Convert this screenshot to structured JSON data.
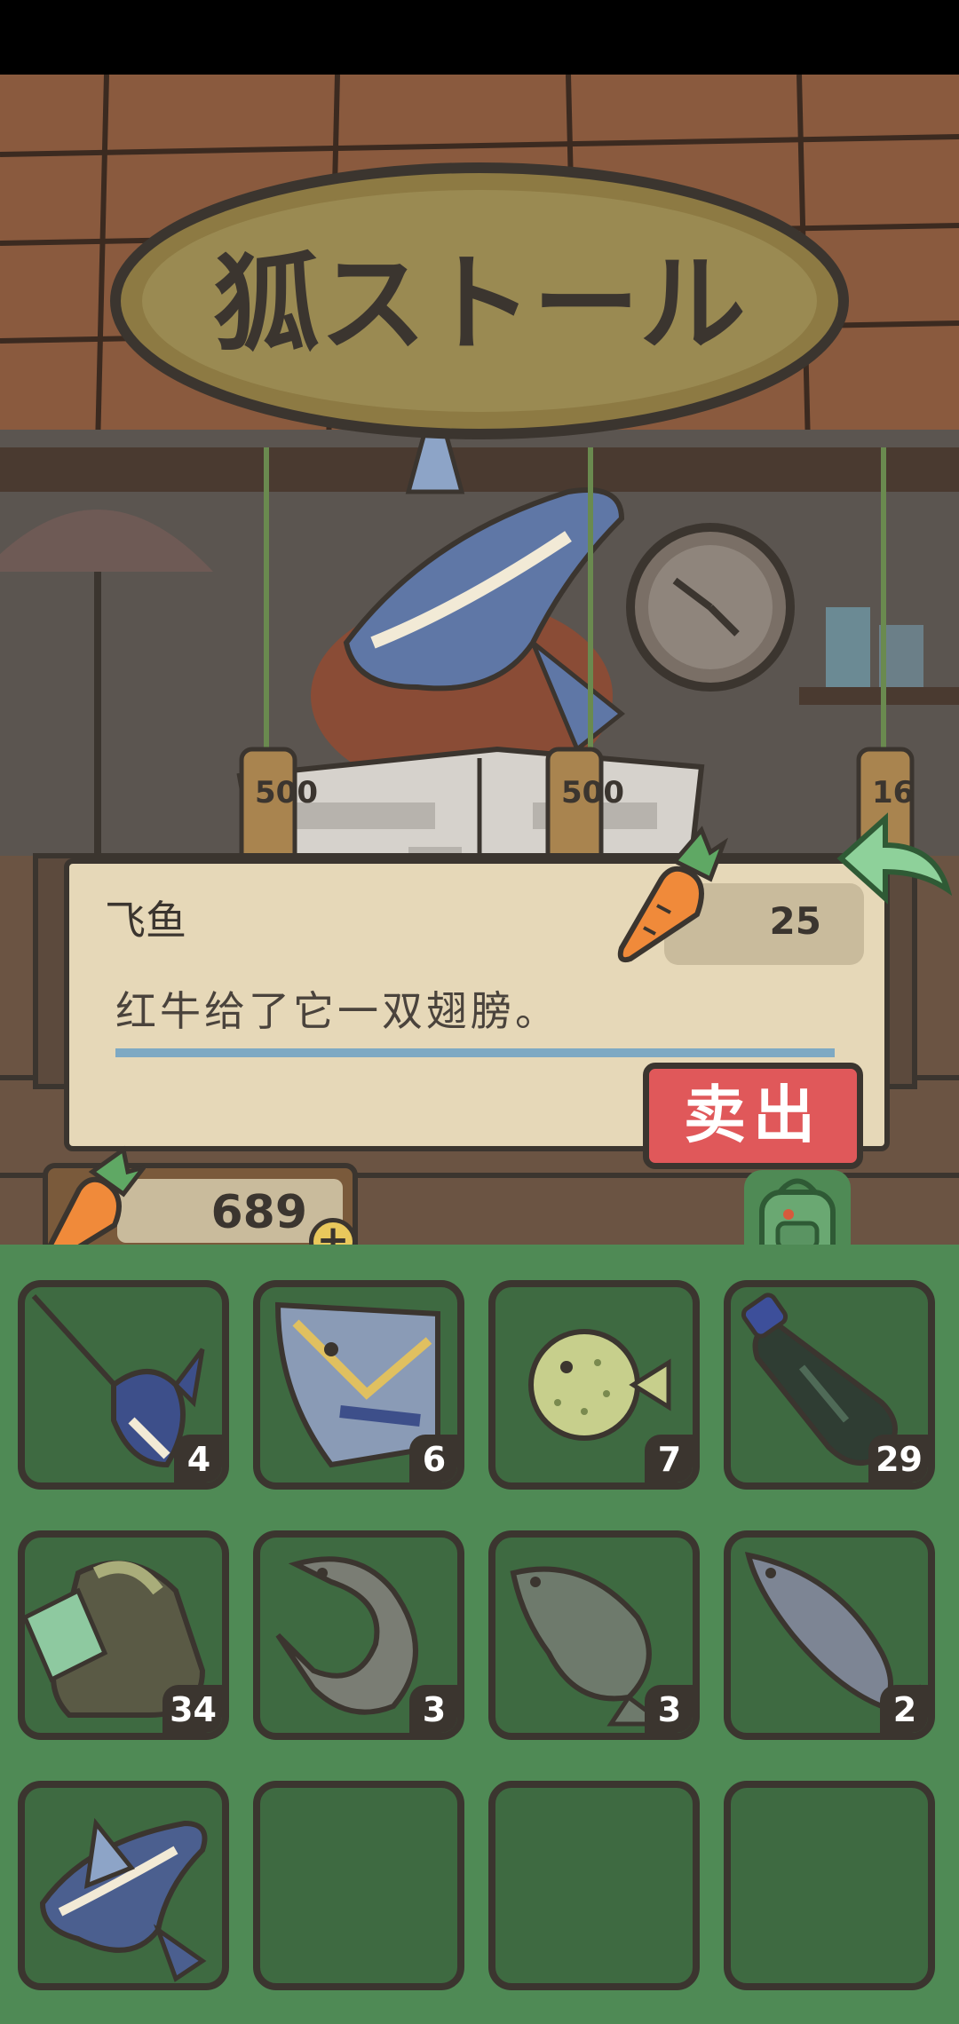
{
  "shop": {
    "sign_text": "狐ストール",
    "tag_prices": [
      "500",
      "500",
      "16"
    ]
  },
  "item": {
    "name": "飞鱼",
    "price": "25",
    "description": "红牛给了它一双翅膀。",
    "sell_label": "卖出"
  },
  "wallet": {
    "carrots": "689"
  },
  "inventory": {
    "slots": [
      {
        "icon": "swordfish-icon",
        "count": "4"
      },
      {
        "icon": "triggerfish-icon",
        "count": "6"
      },
      {
        "icon": "pufferfish-icon",
        "count": "7"
      },
      {
        "icon": "plastic-bottle-icon",
        "count": "29"
      },
      {
        "icon": "old-boot-icon",
        "count": "34"
      },
      {
        "icon": "sturgeon-icon",
        "count": "3"
      },
      {
        "icon": "carp-icon",
        "count": "3"
      },
      {
        "icon": "salmon-icon",
        "count": "2"
      },
      {
        "icon": "flying-fish-icon",
        "count": ""
      },
      {
        "icon": "empty-slot",
        "count": ""
      },
      {
        "icon": "empty-slot",
        "count": ""
      },
      {
        "icon": "empty-slot",
        "count": ""
      }
    ]
  },
  "colors": {
    "inventory_bg": "#4f8a55",
    "slot_bg": "#3e6a41",
    "sell_button": "#e0585a",
    "panel": "#e6d8b8",
    "accent_line": "#7ea9c3"
  }
}
